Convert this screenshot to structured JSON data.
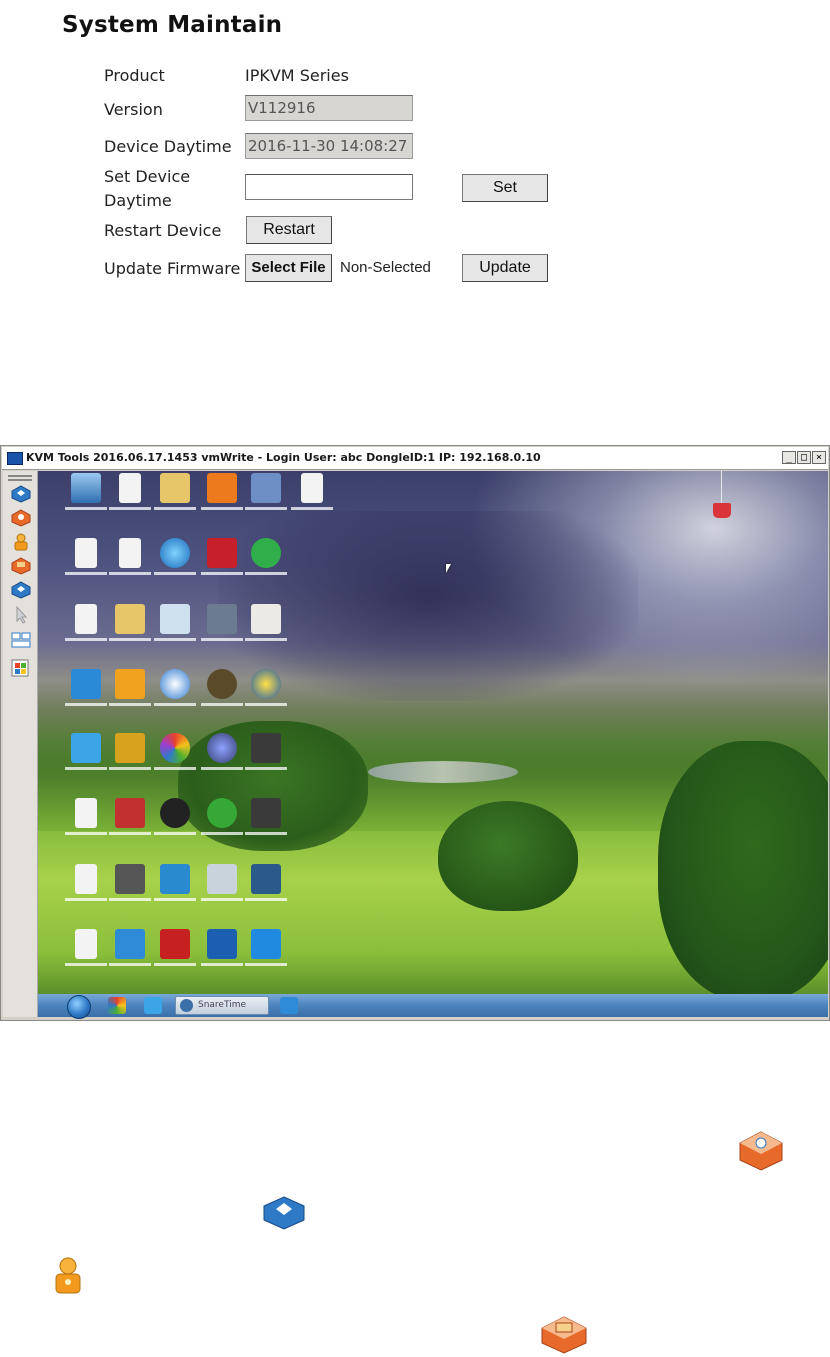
{
  "system_maintain": {
    "title": "System Maintain",
    "product_label": "Product",
    "product_value": "IPKVM Series",
    "version_label": "Version",
    "version_value": "V112916",
    "device_daytime_label": "Device Daytime",
    "device_daytime_value": "2016-11-30 14:08:27",
    "set_daytime_label_1": "Set Device",
    "set_daytime_label_2": "Daytime",
    "set_daytime_value": "",
    "set_button": "Set",
    "restart_label": "Restart Device",
    "restart_button": "Restart",
    "firmware_label": "Update Firmware",
    "select_file_button": "Select File",
    "file_status": "Non-Selected",
    "update_button": "Update"
  },
  "kvm_window": {
    "title": "KVM Tools 2016.06.17.1453 vmWrite - Login User: abc DongleID:1 IP: 192.168.0.10",
    "minimize": "_",
    "maximize": "□",
    "close": "×",
    "toolbar_icons": [
      "blue-cube-icon",
      "orange-connect-icon",
      "user-key-icon",
      "orange-monitor-icon",
      "blue-cube-icon",
      "pointer-icon",
      "keyboard-icon",
      "windows-flag-icon"
    ],
    "taskbar_active_label": "SnareTime"
  },
  "colors": {
    "accent_blue": "#2f7ac6",
    "accent_orange": "#e86a2a",
    "title_bg": "#ffffff",
    "window_bg": "#d4d0c8"
  }
}
